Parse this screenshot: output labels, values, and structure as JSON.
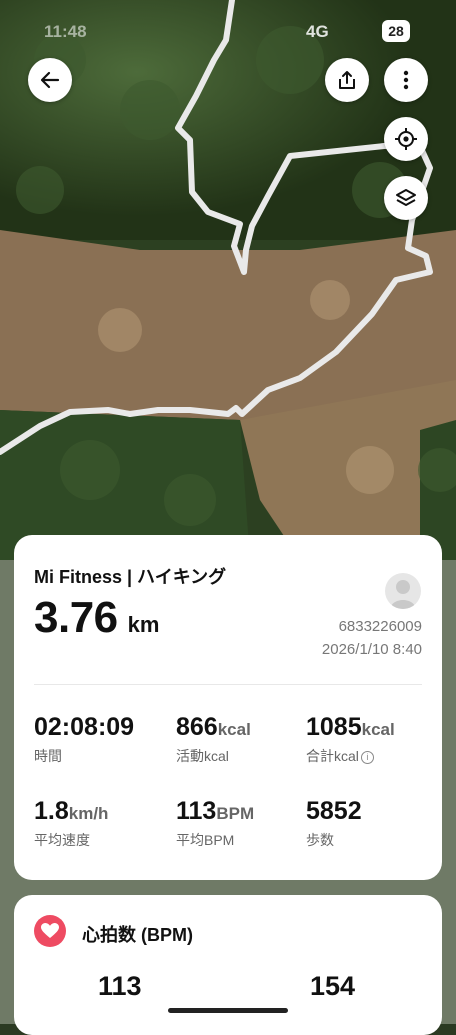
{
  "status_bar": {
    "time": "11:48",
    "network": "4G",
    "battery": "28"
  },
  "map": {
    "route_color": "#e9e9e9"
  },
  "toolbar": {
    "back_icon": "arrow-left-icon",
    "share_icon": "share-icon",
    "more_icon": "more-vertical-icon",
    "locate_icon": "locate-icon",
    "layers_icon": "layers-icon"
  },
  "summary": {
    "title": "Mi Fitness | ハイキング",
    "distance": "3.76",
    "distance_unit": "km",
    "user_id": "6833226009",
    "datetime": "2026/1/10 8:40",
    "stats": [
      {
        "value": "02:08:09",
        "unit": "",
        "label": "時間"
      },
      {
        "value": "866",
        "unit": "kcal",
        "label": "活動kcal"
      },
      {
        "value": "1085",
        "unit": "kcal",
        "label": "合計kcal"
      },
      {
        "value": "1.8",
        "unit": "km/h",
        "label": "平均速度"
      },
      {
        "value": "113",
        "unit": "BPM",
        "label": "平均BPM"
      },
      {
        "value": "5852",
        "unit": "",
        "label": "歩数"
      }
    ]
  },
  "heart_rate": {
    "title": "心拍数 (BPM)",
    "values": [
      "113",
      "154"
    ],
    "accent": "#ee4b62"
  }
}
